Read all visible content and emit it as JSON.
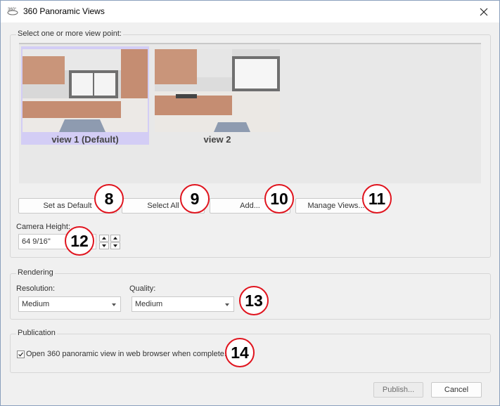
{
  "window": {
    "title": "360 Panoramic Views",
    "title_icon": "360-icon",
    "close_icon": "close-icon"
  },
  "viewpoints": {
    "legend": "Select one or more view point:",
    "items": [
      {
        "label": "view 1 (Default)",
        "selected": true
      },
      {
        "label": "view 2",
        "selected": false
      }
    ]
  },
  "buttons": {
    "set_default": "Set as Default",
    "select_all": "Select All",
    "add": "Add...",
    "manage": "Manage Views...",
    "publish": "Publish...",
    "cancel": "Cancel"
  },
  "camera": {
    "label": "Camera Height:",
    "value": "64 9/16''"
  },
  "rendering": {
    "legend": "Rendering",
    "resolution_label": "Resolution:",
    "resolution_value": "Medium",
    "quality_label": "Quality:",
    "quality_value": "Medium"
  },
  "publication": {
    "legend": "Publication",
    "checkbox_label": "Open 360 panoramic view in web browser when complete.",
    "checked": true
  },
  "callouts": [
    "8",
    "9",
    "10",
    "11",
    "12",
    "13",
    "14"
  ],
  "colors": {
    "callout_border": "#e0141e",
    "selection": "#d3cdf5"
  }
}
